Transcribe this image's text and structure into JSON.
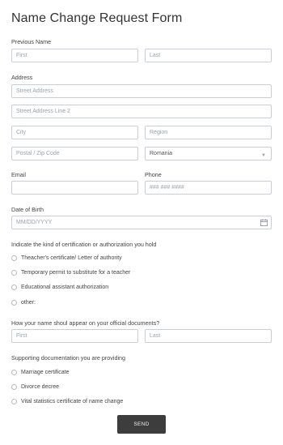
{
  "form": {
    "title": "Name Change Request Form",
    "previous_name": {
      "label": "Previous Name",
      "first_placeholder": "First",
      "last_placeholder": "Last"
    },
    "address": {
      "label": "Address",
      "street1_placeholder": "Street Address",
      "street2_placeholder": "Street Address Line 2",
      "city_placeholder": "City",
      "region_placeholder": "Region",
      "postal_placeholder": "Postal / Zip Code",
      "country_value": "Romania"
    },
    "email": {
      "label": "Email",
      "value": ""
    },
    "phone": {
      "label": "Phone",
      "placeholder": "### ### ####"
    },
    "dob": {
      "label": "Date of Birth",
      "placeholder": "MM/DD/YYYY"
    },
    "certification": {
      "label": "Indicate the kind of certification or authorization you hold",
      "options": [
        "Theacher's certificate/ Letter of authority",
        "Temporary permit to substitute for a teacher",
        "Educational assistant authorization",
        "other:"
      ]
    },
    "new_name": {
      "label": "How your name shoul appear on your official documents?",
      "first_placeholder": "First",
      "last_placeholder": "Last"
    },
    "documentation": {
      "label": "Supporting documentation you are providing",
      "options": [
        "Marriage certificate",
        "Divorce decree",
        "Vital statistics certificate of name change"
      ]
    },
    "submit_label": "SEND"
  },
  "icons": {
    "select_chevron": "chevron-down-icon",
    "date_picker": "calendar-icon"
  }
}
